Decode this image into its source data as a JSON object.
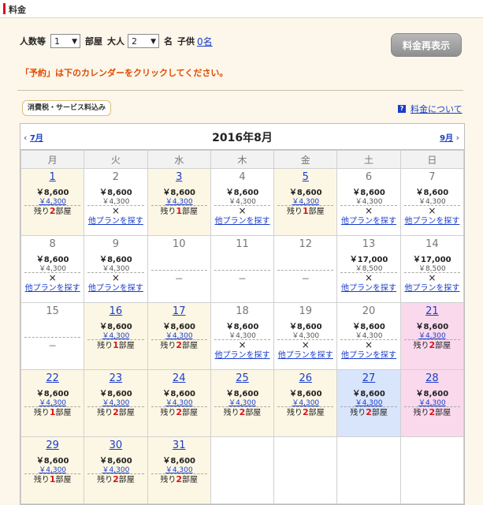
{
  "section_title": "料金",
  "form": {
    "rooms_label": "人数等",
    "rooms_value": "1",
    "rooms_unit": "部屋",
    "adults_label": "大人",
    "adults_value": "2",
    "adults_unit": "名",
    "children_label": "子供",
    "children_link": "0名",
    "refresh_button": "料金再表示"
  },
  "notice": "「予約」は下のカレンダーをクリックしてください。",
  "tax_badge": "消費税・サービス料込み",
  "fee_link": "料金について",
  "calendar": {
    "prev_link": "7月",
    "next_link": "9月",
    "month_title": "2016年8月",
    "weekdays": [
      "月",
      "火",
      "水",
      "木",
      "金",
      "土",
      "日"
    ],
    "labels": {
      "remaining_prefix": "残り",
      "remaining_suffix": "部屋",
      "other_plans": "他プランを探す",
      "x": "×",
      "dash": "－"
    },
    "weeks": [
      [
        {
          "day": "1",
          "state": "avail",
          "price": "￥8,600",
          "child": "￥4,300",
          "remaining": "2"
        },
        {
          "day": "2",
          "state": "full",
          "price": "￥8,600",
          "child": "￥4,300"
        },
        {
          "day": "3",
          "state": "avail",
          "price": "￥8,600",
          "child": "￥4,300",
          "remaining": "1"
        },
        {
          "day": "4",
          "state": "full",
          "price": "￥8,600",
          "child": "￥4,300"
        },
        {
          "day": "5",
          "state": "avail",
          "price": "￥8,600",
          "child": "￥4,300",
          "remaining": "1"
        },
        {
          "day": "6",
          "state": "full",
          "price": "￥8,600",
          "child": "￥4,300"
        },
        {
          "day": "7",
          "state": "full",
          "price": "￥8,600",
          "child": "￥4,300"
        }
      ],
      [
        {
          "day": "8",
          "state": "full",
          "price": "￥8,600",
          "child": "￥4,300"
        },
        {
          "day": "9",
          "state": "full",
          "price": "￥8,600",
          "child": "￥4,300"
        },
        {
          "day": "10",
          "state": "none"
        },
        {
          "day": "11",
          "state": "none"
        },
        {
          "day": "12",
          "state": "none"
        },
        {
          "day": "13",
          "state": "full",
          "price": "￥17,000",
          "child": "￥8,500"
        },
        {
          "day": "14",
          "state": "full",
          "price": "￥17,000",
          "child": "￥8,500"
        }
      ],
      [
        {
          "day": "15",
          "state": "none"
        },
        {
          "day": "16",
          "state": "avail",
          "price": "￥8,600",
          "child": "￥4,300",
          "remaining": "1"
        },
        {
          "day": "17",
          "state": "avail",
          "price": "￥8,600",
          "child": "￥4,300",
          "remaining": "2"
        },
        {
          "day": "18",
          "state": "full",
          "price": "￥8,600",
          "child": "￥4,300"
        },
        {
          "day": "19",
          "state": "full",
          "price": "￥8,600",
          "child": "￥4,300"
        },
        {
          "day": "20",
          "state": "full",
          "price": "￥8,600",
          "child": "￥4,300"
        },
        {
          "day": "21",
          "state": "avail",
          "bg": "sun",
          "price": "￥8,600",
          "child": "￥4,300",
          "remaining": "2"
        }
      ],
      [
        {
          "day": "22",
          "state": "avail",
          "price": "￥8,600",
          "child": "￥4,300",
          "remaining": "1"
        },
        {
          "day": "23",
          "state": "avail",
          "price": "￥8,600",
          "child": "￥4,300",
          "remaining": "2"
        },
        {
          "day": "24",
          "state": "avail",
          "price": "￥8,600",
          "child": "￥4,300",
          "remaining": "2"
        },
        {
          "day": "25",
          "state": "avail",
          "price": "￥8,600",
          "child": "￥4,300",
          "remaining": "2"
        },
        {
          "day": "26",
          "state": "avail",
          "price": "￥8,600",
          "child": "￥4,300",
          "remaining": "2"
        },
        {
          "day": "27",
          "state": "avail",
          "bg": "sat",
          "price": "￥8,600",
          "child": "￥4,300",
          "remaining": "2"
        },
        {
          "day": "28",
          "state": "avail",
          "bg": "sun",
          "price": "￥8,600",
          "child": "￥4,300",
          "remaining": "2"
        }
      ],
      [
        {
          "day": "29",
          "state": "avail",
          "price": "￥8,600",
          "child": "￥4,300",
          "remaining": "1"
        },
        {
          "day": "30",
          "state": "avail",
          "price": "￥8,600",
          "child": "￥4,300",
          "remaining": "2"
        },
        {
          "day": "31",
          "state": "avail",
          "price": "￥8,600",
          "child": "￥4,300",
          "remaining": "2"
        },
        {
          "day": "",
          "state": "blank"
        },
        {
          "day": "",
          "state": "blank"
        },
        {
          "day": "",
          "state": "blank"
        },
        {
          "day": "",
          "state": "blank"
        }
      ]
    ]
  },
  "colors": {
    "accent_red": "#d8141a",
    "link_blue": "#1a3ccc",
    "notice_orange": "#e04a00",
    "avail_bg": "#fcf7e4",
    "sat_bg": "#d9e5fb",
    "sun_bg": "#fad9ec"
  }
}
